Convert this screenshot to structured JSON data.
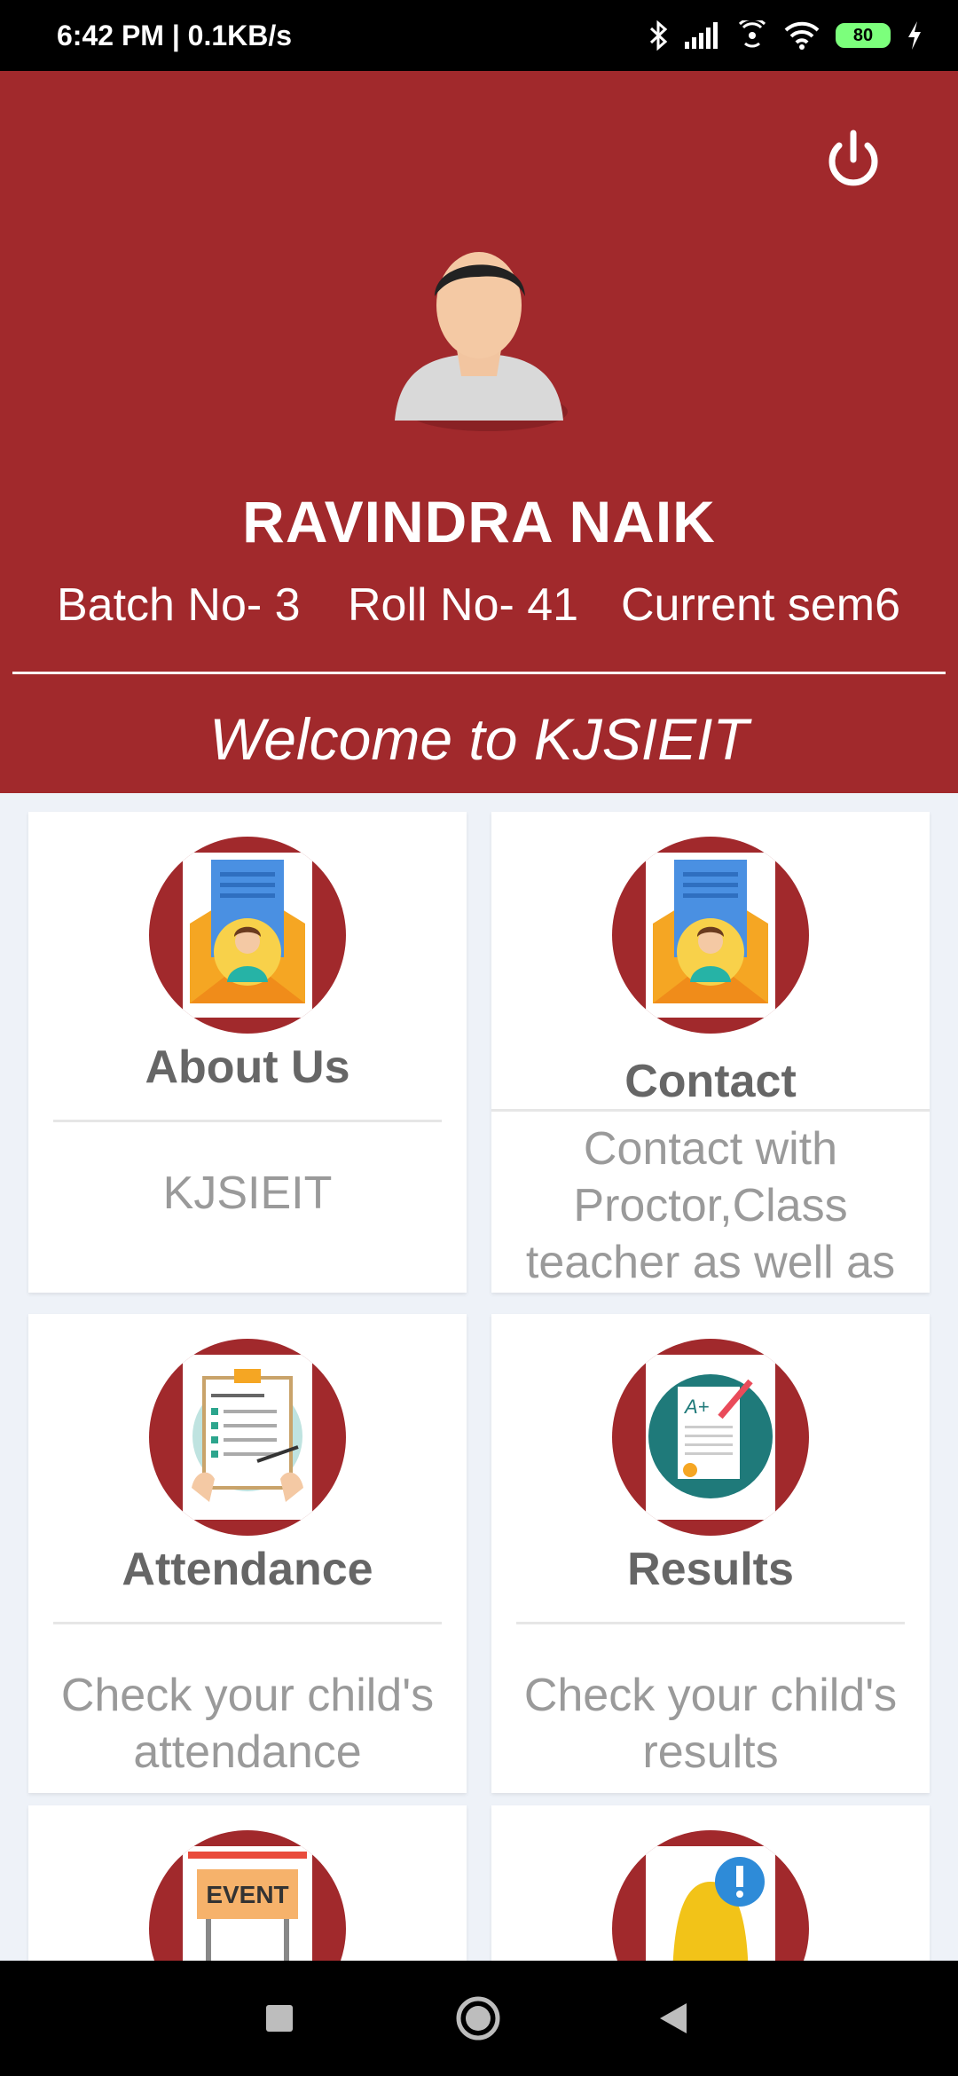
{
  "status_bar": {
    "time_speed": "6:42 PM | 0.1KB/s",
    "battery": "80"
  },
  "header": {
    "name": "RAVINDRA NAIK",
    "batch": "Batch No- 3",
    "roll": "Roll No- 41",
    "semester": "Current sem6",
    "welcome": "Welcome to KJSIEIT"
  },
  "cards": [
    {
      "title": "About Us",
      "desc": "KJSIEIT"
    },
    {
      "title": "Contact",
      "desc": "Contact with Proctor,Class teacher as well as"
    },
    {
      "title": "Attendance",
      "desc": "Check your child's attendance"
    },
    {
      "title": "Results",
      "desc": "Check your child's results"
    },
    {
      "title": "",
      "desc": "",
      "icon_text": "EVENT"
    },
    {
      "title": "",
      "desc": ""
    }
  ],
  "colors": {
    "brand": "#a1292c",
    "background": "#eef2f8"
  }
}
